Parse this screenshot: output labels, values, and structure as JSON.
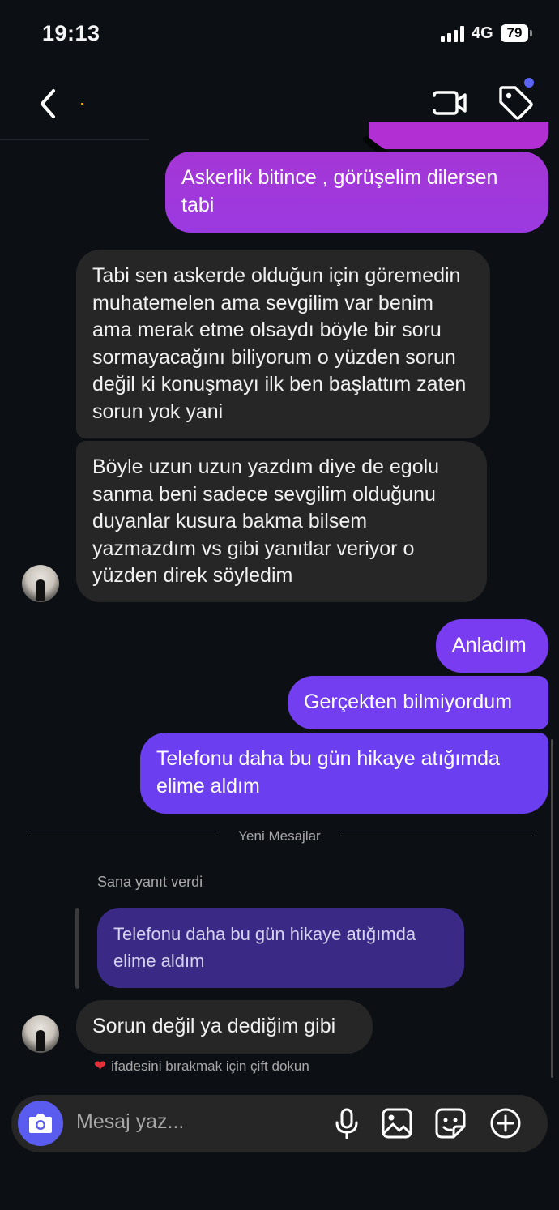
{
  "status": {
    "time": "19:13",
    "network": "4G",
    "battery": "79"
  },
  "header": {
    "back_label": "",
    "contact_name": ""
  },
  "messages": {
    "m1": "Askerlik bitince , görüşelim dilersen tabi",
    "m2": "Tabi sen askerde olduğun için göremedin muhatemelen ama sevgilim var benim ama merak etme olsaydı böyle bir soru sormayacağını biliyorum o yüzden sorun değil ki konuşmayı ilk ben başlattım zaten sorun yok yani",
    "m3": "Böyle uzun uzun yazdım diye de egolu sanma beni sadece sevgilim olduğunu duyanlar kusura bakma bilsem yazmazdım vs gibi yanıtlar veriyor o yüzden direk söyledim",
    "m4": "Anladım",
    "m5": "Gerçekten bilmiyordum",
    "m6": "Telefonu daha bu gün hikaye atığımda elime aldım",
    "separator": "Yeni Mesajlar",
    "reply_label": "Sana yanıt verdi",
    "quoted": "Telefonu daha bu gün hikaye atığımda elime aldım",
    "m7": "Sorun değil ya dediğim gibi",
    "hint": "ifadesini bırakmak için çift dokun"
  },
  "composer": {
    "placeholder": "Mesaj yaz..."
  },
  "icons": {
    "back": "chevron-left-icon",
    "video": "video-camera-icon",
    "tag": "tag-icon",
    "camera": "camera-icon",
    "mic": "microphone-icon",
    "gallery": "image-icon",
    "sticker": "sticker-icon",
    "add": "plus-circle-icon",
    "heart": "heart-icon"
  },
  "colors": {
    "background": "#0c1014",
    "incoming_bubble": "#262626",
    "outgoing_top": "#a433d4",
    "outgoing_bottom": "#6b3df0",
    "accent": "#5b63f5",
    "quoted_bubble": "#3a2a86"
  }
}
